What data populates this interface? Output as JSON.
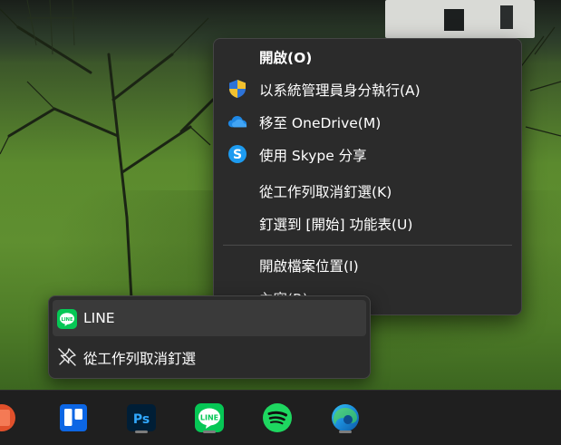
{
  "context_menu": {
    "items": [
      {
        "label": "開啟(O)",
        "icon": ""
      },
      {
        "label": "以系統管理員身分執行(A)",
        "icon": "uac-shield-icon"
      },
      {
        "label": "移至 OneDrive(M)",
        "icon": "onedrive-icon"
      },
      {
        "label": "使用 Skype 分享",
        "icon": "skype-icon"
      },
      {
        "label": "從工作列取消釘選(K)",
        "icon": ""
      },
      {
        "label": "釘選到 [開始] 功能表(U)",
        "icon": ""
      },
      {
        "label": "開啟檔案位置(I)",
        "icon": ""
      },
      {
        "label": "內容(R)",
        "icon": ""
      }
    ]
  },
  "jump_list": {
    "app_label": "LINE",
    "unpin_label": "從工作列取消釘選"
  },
  "taskbar": {
    "apps": [
      {
        "name": "office",
        "icon": "office-icon"
      },
      {
        "name": "trello",
        "icon": "trello-icon"
      },
      {
        "name": "photoshop",
        "icon": "photoshop-icon",
        "badge": "Ps"
      },
      {
        "name": "line",
        "icon": "line-icon",
        "badge": "LINE"
      },
      {
        "name": "spotify",
        "icon": "spotify-icon"
      },
      {
        "name": "edge",
        "icon": "edge-icon"
      }
    ]
  },
  "colors": {
    "menu_bg": "#2b2b2b",
    "line_green": "#06c755",
    "spotify_green": "#1ed760",
    "trello_blue": "#0c66e4",
    "ps_blue": "#31a8ff",
    "taskbar_bg": "#1f1f1f"
  }
}
